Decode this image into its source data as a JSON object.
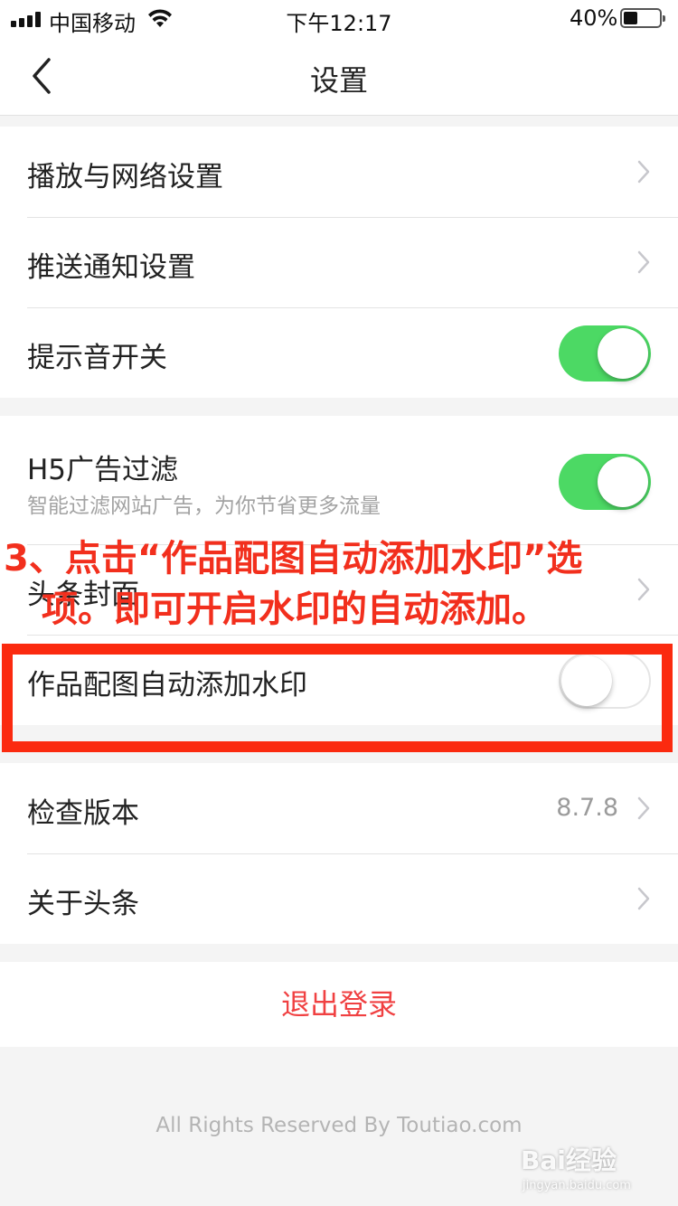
{
  "status_bar": {
    "carrier": "中国移动",
    "time": "下午12:17",
    "battery_percent_text": "40%",
    "battery_level": 0.4
  },
  "nav": {
    "title": "设置"
  },
  "settings": {
    "group1": [
      {
        "label": "播放与网络设置",
        "control": "chevron"
      },
      {
        "label": "推送通知设置",
        "control": "chevron"
      },
      {
        "label": "提示音开关",
        "control": "toggle",
        "on": true
      }
    ],
    "group2": {
      "h5_filter": {
        "label": "H5广告过滤",
        "sub": "智能过滤网站广告，为你节省更多流量",
        "on": true
      },
      "cover": {
        "label": "头条封面"
      },
      "watermark": {
        "label": "作品配图自动添加水印",
        "on": false
      }
    },
    "group3": [
      {
        "label": "检查版本",
        "value": "8.7.8"
      },
      {
        "label": "关于头条"
      }
    ]
  },
  "logout_label": "退出登录",
  "footer_text": "All Rights Reserved By Toutiao.com",
  "annotation": {
    "line1": "3、点击“作品配图自动添加水印”选",
    "line2": "项。即可开启水印的自动添加。",
    "color": "#f22f1d"
  },
  "watermark_overlay": {
    "logo": "Bai经验",
    "url": "jingyan.baidu.com"
  },
  "colors": {
    "toggle_on": "#4cd964",
    "logout_text": "#f04142",
    "highlight_box": "#fb2a0f"
  }
}
